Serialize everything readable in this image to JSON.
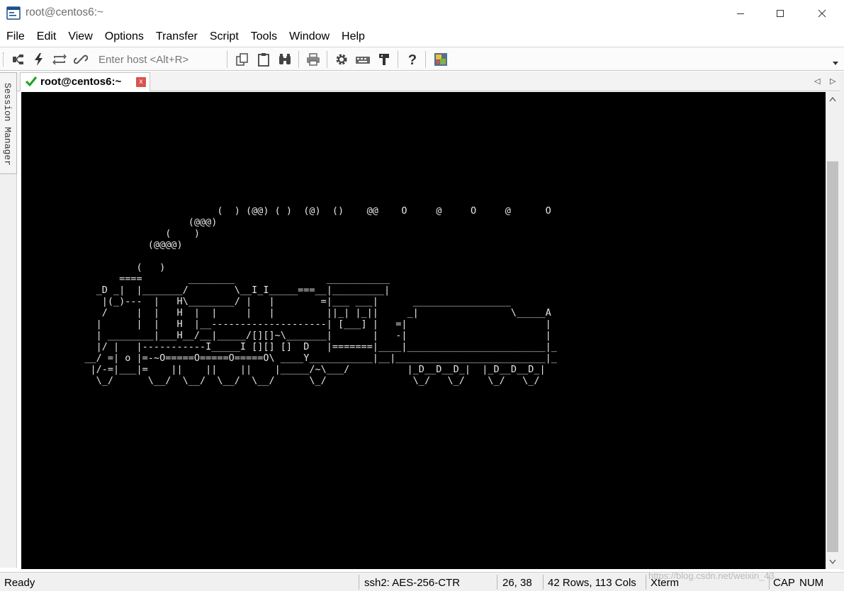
{
  "window": {
    "title": "root@centos6:~"
  },
  "menu": [
    "File",
    "Edit",
    "View",
    "Options",
    "Transfer",
    "Script",
    "Tools",
    "Window",
    "Help"
  ],
  "toolbar": {
    "host_placeholder": "Enter host <Alt+R>"
  },
  "side_panel": {
    "label": "Session Manager"
  },
  "tab": {
    "title": "root@centos6:~",
    "close": "x"
  },
  "terminal": {
    "lines": [
      "",
      "",
      "",
      "",
      "",
      "",
      "",
      "",
      "",
      "",
      "                                  (  ) (@@) ( )  (@)  ()    @@    O     @     O     @      O",
      "                             (@@@)",
      "                         (    )",
      "                      (@@@@)",
      "",
      "                    (   )",
      "                 ====        ________                ___________",
      "             _D _|  |_______/        \\__I_I_____===__|_________|",
      "              |(_)---  |   H\\________/ |   |        =|___ ___|      _________________",
      "              /     |  |   H  |  |     |   |         ||_| |_||     _|                \\_____A",
      "             |      |  |   H  |__--------------------| [___] |   =|                        |",
      "             | ________|___H__/__|_____/[][]~\\_______|       |   -|                        |",
      "             |/ |   |-----------I_____I [][] []  D   |=======|____|________________________|_",
      "           __/ =| o |=-~O=====O=====O=====O\\ ____Y___________|__|__________________________|_",
      "            |/-=|___|=    ||    ||    ||    |_____/~\\___/          |_D__D__D_|  |_D__D__D_|",
      "             \\_/      \\__/  \\__/  \\__/  \\__/      \\_/               \\_/   \\_/    \\_/   \\_/"
    ]
  },
  "status": {
    "ready": "Ready",
    "encryption": "ssh2: AES-256-CTR",
    "cursor": "26,  38",
    "size": "42 Rows, 113 Cols",
    "terminal_type": "Xterm",
    "caps": "CAP",
    "num": "NUM"
  },
  "watermark": "https://blog.csdn.net/weixin_43..."
}
